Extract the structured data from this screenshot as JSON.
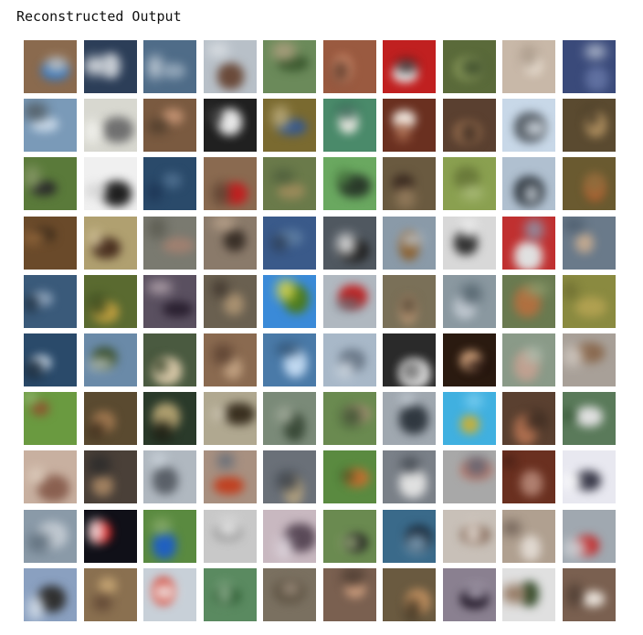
{
  "title": "Reconstructed Output",
  "grid": {
    "rows": 10,
    "cols": 10,
    "tiles": [
      [
        "#8a6a4e",
        "#3a76b8",
        "#d9d2c9"
      ],
      [
        "#2c3e58",
        "#c0c6ce",
        "#e6e9ec"
      ],
      [
        "#4f6c88",
        "#8fa3b6",
        "#c8d2dc"
      ],
      [
        "#b8c0c8",
        "#6a4a3a",
        "#dfe3e7"
      ],
      [
        "#6b8a5a",
        "#3c5a30",
        "#b0a080"
      ],
      [
        "#9a5a40",
        "#d08a6a",
        "#5a3a2a"
      ],
      [
        "#c02020",
        "#f0f0f0",
        "#202020"
      ],
      [
        "#5a6a3a",
        "#8a9a5a",
        "#3a4a2a"
      ],
      [
        "#c8b8a8",
        "#e8ddd0",
        "#a89888"
      ],
      [
        "#3a4a7a",
        "#6070a0",
        "#c0c8d8"
      ],
      [
        "#7a9ab8",
        "#c8d8e8",
        "#505a60"
      ],
      [
        "#d8d8d0",
        "#707070",
        "#f4f4f0"
      ],
      [
        "#7a5a40",
        "#c09070",
        "#4a3a2a"
      ],
      [
        "#202020",
        "#e8e8e8",
        "#404040"
      ],
      [
        "#7a6a30",
        "#3a5a8a",
        "#c0b080"
      ],
      [
        "#4a8a6a",
        "#e8e8e0",
        "#2a5a4a"
      ],
      [
        "#6a3020",
        "#f0e8e0",
        "#c08060"
      ],
      [
        "#5a4030",
        "#9a7050",
        "#3a2a20"
      ],
      [
        "#c8d8e8",
        "#505860",
        "#e8f0f8"
      ],
      [
        "#5a4a30",
        "#b09060",
        "#3a3020"
      ],
      [
        "#5a7a3a",
        "#2a2a2a",
        "#8a9a6a"
      ],
      [
        "#f0f0f0",
        "#202020",
        "#d0d0d0"
      ],
      [
        "#2a4a6a",
        "#4a6a8a",
        "#1a3050"
      ],
      [
        "#8a6a50",
        "#c02020",
        "#5a4030"
      ],
      [
        "#6a7a4a",
        "#9a8a5a",
        "#4a5a3a"
      ],
      [
        "#6aa860",
        "#2a3a2a",
        "#4a7a40"
      ],
      [
        "#6a5a40",
        "#3a2a20",
        "#9a8060"
      ],
      [
        "#8aa050",
        "#6a7a3a",
        "#b0c080"
      ],
      [
        "#b0c0d0",
        "#303840",
        "#e0e8f0"
      ],
      [
        "#6a5a30",
        "#b06030",
        "#8a7040"
      ],
      [
        "#6a4a2a",
        "#3a2a1a",
        "#a07040"
      ],
      [
        "#b0a070",
        "#4a3020",
        "#d8c8a0"
      ],
      [
        "#7a7a70",
        "#a08070",
        "#5a5a50"
      ],
      [
        "#8a7a6a",
        "#3a3028",
        "#c0a890"
      ],
      [
        "#3a5a8a",
        "#5a7aa0",
        "#2a3a50"
      ],
      [
        "#505860",
        "#202020",
        "#f0f0f0"
      ],
      [
        "#8a9aa8",
        "#8a6030",
        "#c0ccd8"
      ],
      [
        "#d8d8d8",
        "#303030",
        "#f8f8f8"
      ],
      [
        "#c03030",
        "#e0e0e0",
        "#8a9ab0"
      ],
      [
        "#6a7a8a",
        "#c0a890",
        "#4a5a6a"
      ],
      [
        "#3a5a7a",
        "#8aa0b8",
        "#1a2a3a"
      ],
      [
        "#5a6a30",
        "#c0a040",
        "#3a4a20"
      ],
      [
        "#5a5060",
        "#2a2030",
        "#c0b0b8"
      ],
      [
        "#6a6050",
        "#a89070",
        "#3a3028"
      ],
      [
        "#3a8ad8",
        "#4a7a20",
        "#e0d840"
      ],
      [
        "#b0b8c0",
        "#c02020",
        "#606870"
      ],
      [
        "#7a7058",
        "#b09070",
        "#4a4030"
      ],
      [
        "#8a98a0",
        "#c0c8d0",
        "#50606a"
      ],
      [
        "#6a7a50",
        "#b07040",
        "#90a070"
      ],
      [
        "#8a8a40",
        "#b0a050",
        "#6a6a30"
      ],
      [
        "#2a4a6a",
        "#c8d8e8",
        "#1a2a3a"
      ],
      [
        "#6a8aa8",
        "#3a5030",
        "#c0c8c0"
      ],
      [
        "#4a5a40",
        "#d8c8a8",
        "#2a3a20"
      ],
      [
        "#8a6a50",
        "#c0a080",
        "#5a4030"
      ],
      [
        "#4a7aa8",
        "#c0d8f0",
        "#2a4a6a"
      ],
      [
        "#a8b8c8",
        "#6a7888",
        "#d8e0e8"
      ],
      [
        "#2a2a2a",
        "#e8e8e8",
        "#6a6a6a"
      ],
      [
        "#2a1a10",
        "#d8a880",
        "#1a0a08"
      ],
      [
        "#8a9a88",
        "#c0a090",
        "#b0c0b0"
      ],
      [
        "#a8a098",
        "#8a6a50",
        "#d0c8c0"
      ],
      [
        "#6a9a40",
        "#8a5a30",
        "#a0c080"
      ],
      [
        "#5a4a30",
        "#a07850",
        "#3a2a1a"
      ],
      [
        "#2a3a2a",
        "#b0a070",
        "#1a1a10"
      ],
      [
        "#b0a890",
        "#3a3020",
        "#d8d0c0"
      ],
      [
        "#7a8a78",
        "#3a4a38",
        "#a8b0a0"
      ],
      [
        "#6a8a50",
        "#a09070",
        "#3a5030"
      ],
      [
        "#a0a8b0",
        "#303840",
        "#d0d8e0"
      ],
      [
        "#40b0e0",
        "#c0b040",
        "#80d0f0"
      ],
      [
        "#5a4030",
        "#b07050",
        "#3a2a20"
      ],
      [
        "#5a7a5a",
        "#e0e0e0",
        "#2a4a2a"
      ],
      [
        "#c8b0a0",
        "#8a6050",
        "#e0d0c0"
      ],
      [
        "#4a4038",
        "#a08060",
        "#2a2a2a"
      ],
      [
        "#b0b8c0",
        "#5a6068",
        "#d8e0e8"
      ],
      [
        "#a89080",
        "#c04020",
        "#5a6878"
      ],
      [
        "#6a7078",
        "#b0a080",
        "#3a4048"
      ],
      [
        "#5a8a40",
        "#c07030",
        "#2a4a20"
      ],
      [
        "#7a8088",
        "#e0e0e0",
        "#3a4048"
      ],
      [
        "#a8a8a8",
        "#c08070",
        "#5a6070"
      ],
      [
        "#6a3020",
        "#b08070",
        "#3a1810"
      ],
      [
        "#e8e8f0",
        "#3a3a4a",
        "#ffffff"
      ],
      [
        "#8a9aa8",
        "#c0c8d0",
        "#5a6a78"
      ],
      [
        "#101018",
        "#d02020",
        "#ffffff"
      ],
      [
        "#5a8a40",
        "#2060c0",
        "#90b070"
      ],
      [
        "#c8c8c8",
        "#909090",
        "#e8e8e8"
      ],
      [
        "#c8b8c0",
        "#5a4a58",
        "#e0d8e0"
      ],
      [
        "#6a8a50",
        "#1a1a1a",
        "#a0b080"
      ],
      [
        "#3a6a8a",
        "#1a2a3a",
        "#80a0b8"
      ],
      [
        "#c8c0b8",
        "#8a7060",
        "#e8e0d8"
      ],
      [
        "#b0a090",
        "#e0d8d0",
        "#6a5a50"
      ],
      [
        "#a0a8b0",
        "#c03030",
        "#d0d4d8"
      ],
      [
        "#8aa0c0",
        "#303030",
        "#e0e8f0"
      ],
      [
        "#8a7050",
        "#c0a070",
        "#5a4030"
      ],
      [
        "#c8d0d8",
        "#d03020",
        "#f0f0f0"
      ],
      [
        "#5a8a60",
        "#2a5a30",
        "#90b090"
      ],
      [
        "#7a7060",
        "#5a5040",
        "#a09080"
      ],
      [
        "#7a6050",
        "#d0a080",
        "#4a3a30"
      ],
      [
        "#6a5a40",
        "#c09060",
        "#3a3020"
      ],
      [
        "#8a8090",
        "#1a1020",
        "#c0b8c8"
      ],
      [
        "#e0e0e0",
        "#3a5030",
        "#8a6a50"
      ],
      [
        "#7a6050",
        "#e8e0d8",
        "#4a3a30"
      ]
    ]
  }
}
